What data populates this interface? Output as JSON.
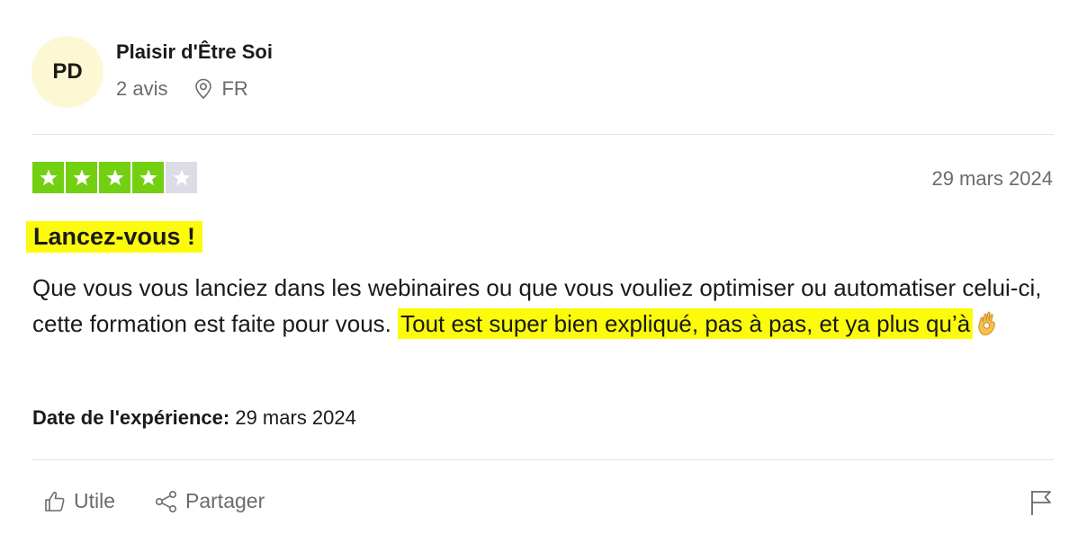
{
  "reviewer": {
    "initials": "PD",
    "name": "Plaisir d'Être Soi",
    "reviews_count": "2 avis",
    "country": "FR"
  },
  "review": {
    "rating": 4,
    "rating_max": 5,
    "date": "29 mars 2024",
    "title": "Lancez-vous !",
    "body_plain": "Que vous vous lanciez dans les webinaires ou que vous vouliez optimiser ou automatiser celui-ci, cette formation est faite pour vous. ",
    "body_highlight": "Tout est super bien expliqué, pas à pas, et ya plus qu’à",
    "body_emoji": "ok-hand-icon",
    "experience_label": "Date de l'expérience:",
    "experience_date": "29 mars 2024"
  },
  "actions": {
    "useful_label": "Utile",
    "share_label": "Partager",
    "report_icon": "flag-icon"
  },
  "colors": {
    "star_on": "#73cf11",
    "star_off": "#dcdce6",
    "highlight": "#fbfb0b",
    "avatar_bg": "#fdf7d4"
  }
}
